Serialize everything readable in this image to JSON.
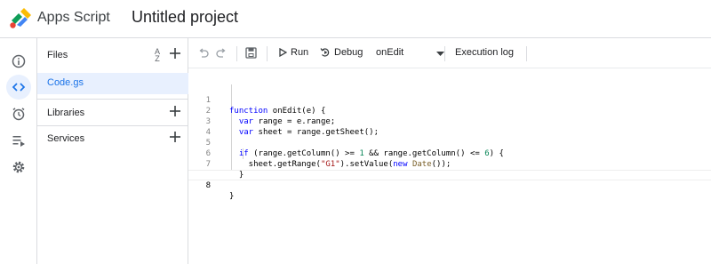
{
  "header": {
    "brand": "Apps Script",
    "project_title": "Untitled project"
  },
  "rail": [
    {
      "icon": "info-icon"
    },
    {
      "icon": "code-icon",
      "active": true
    },
    {
      "icon": "alarm-clock-icon"
    },
    {
      "icon": "executions-icon"
    },
    {
      "icon": "gear-icon"
    }
  ],
  "sidebar": {
    "files_label": "Files",
    "sort_label_top": "A",
    "sort_label_bottom": "Z",
    "file_name": "Code.gs",
    "libraries_label": "Libraries",
    "services_label": "Services"
  },
  "toolbar": {
    "run_label": "Run",
    "debug_label": "Debug",
    "function_select": "onEdit",
    "execution_log_label": "Execution log"
  },
  "code": {
    "line_numbers": [
      "1",
      "2",
      "3",
      "4",
      "5",
      "6",
      "7",
      "8"
    ],
    "current_line": "8"
  }
}
